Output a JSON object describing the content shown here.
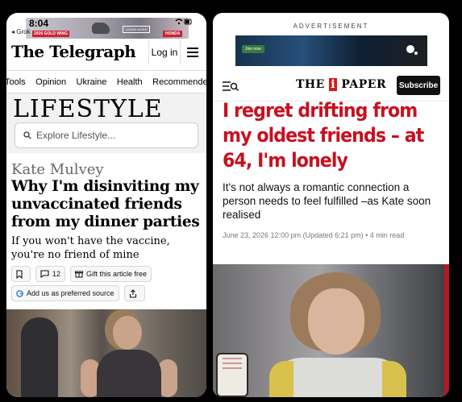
{
  "left": {
    "status": {
      "time": "8:04",
      "back_label": "◂ Grok"
    },
    "ad": {
      "tag": "2026 GOLD WING",
      "cta": "LEARN MORE",
      "brand": "HONDA"
    },
    "header": {
      "logo": "The Telegraph",
      "login": "Log in"
    },
    "nav": [
      "Tools",
      "Opinion",
      "Ukraine",
      "Health",
      "Recommended"
    ],
    "section": {
      "title": "LIFESTYLE",
      "search_placeholder": "Explore Lifestyle..."
    },
    "article": {
      "author": "Kate Mulvey",
      "headline": "Why I'm disinviting my unvaccinated friends from my dinner parties",
      "standfirst": "If you won't have the vaccine, you're no friend of mine",
      "comments": "12",
      "gift_label": "Gift this article free",
      "preferred_label": "Add us as preferred source"
    }
  },
  "right": {
    "ad_label": "ADVERTISEMENT",
    "ad_cta": "Join now",
    "header": {
      "logo_pre": "THE ",
      "logo_i": "i",
      "logo_post": " PAPER",
      "subscribe": "Subscribe"
    },
    "article": {
      "headline": "I regret drifting from my oldest friends – at 64, I'm lonely",
      "standfirst": "It's not always a romantic connection a person needs to feel fulfilled –as Kate soon realised",
      "date": "June 23, 2026 12:00 pm (Updated 6:21 pm)",
      "read_time": "4 min read"
    }
  },
  "colors": {
    "ipaper_red": "#c8101f",
    "telegraph_black": "#000000"
  }
}
